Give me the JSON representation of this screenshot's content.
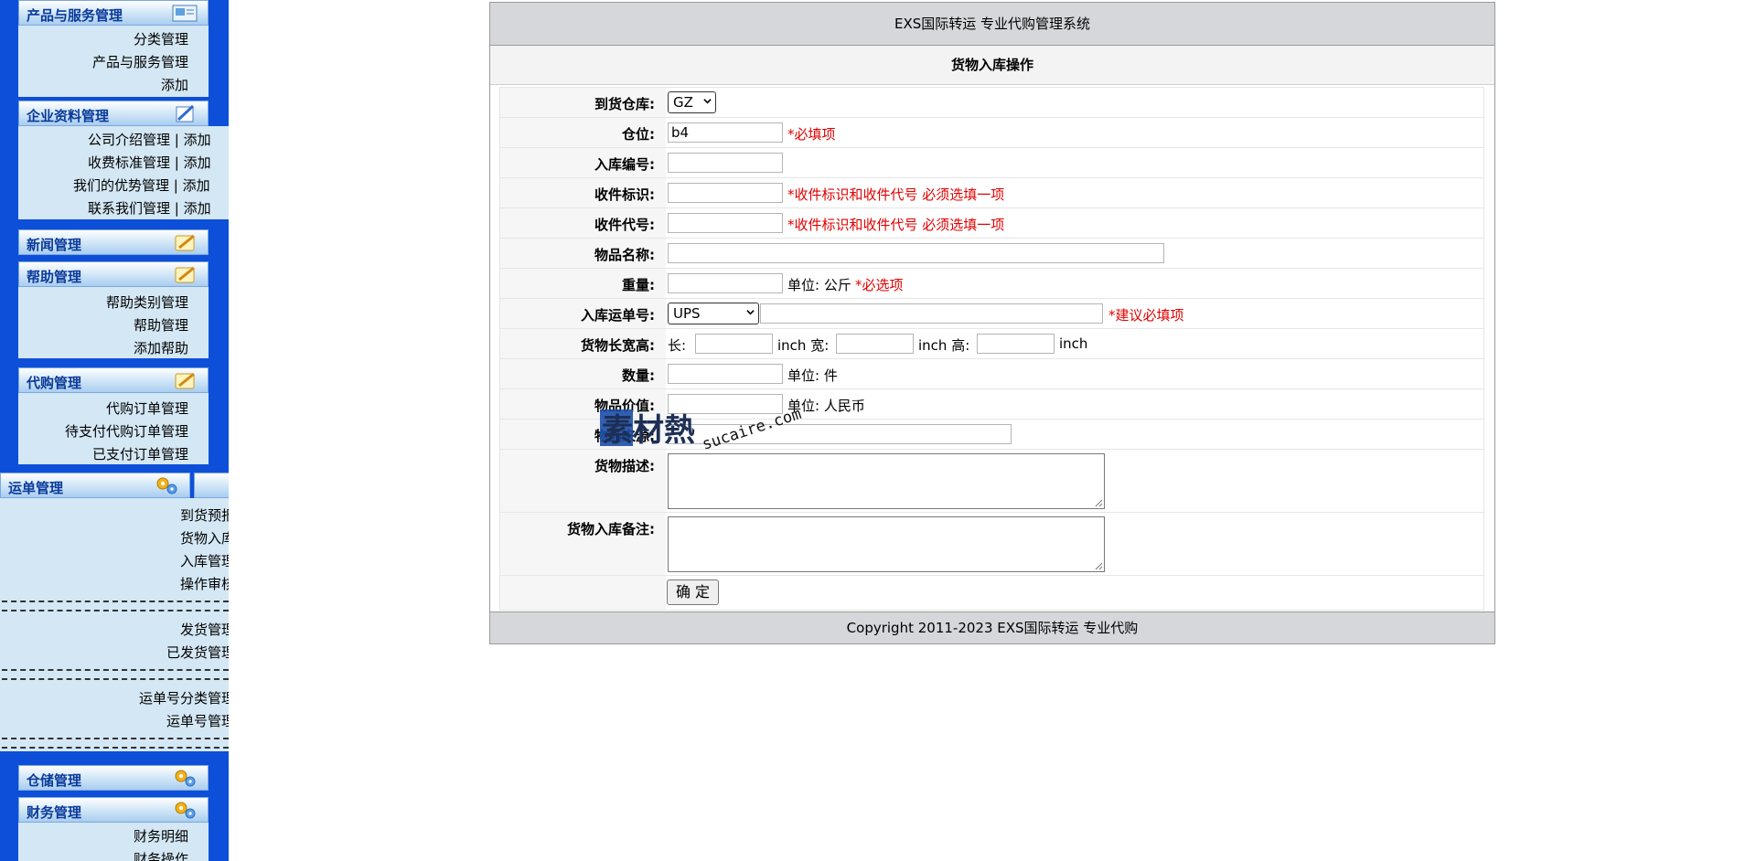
{
  "sidebar": {
    "product_group": {
      "title": "产品与服务管理",
      "items": [
        "分类管理",
        "产品与服务管理",
        "添加"
      ]
    },
    "company_group": {
      "title": "企业资料管理",
      "items": [
        "公司介绍管理 | 添加",
        "收费标准管理 | 添加",
        "我们的优势管理 | 添加",
        "联系我们管理 | 添加"
      ]
    },
    "news_group": {
      "title": "新闻管理"
    },
    "help_group": {
      "title": "帮助管理",
      "items": [
        "帮助类别管理",
        "帮助管理",
        "添加帮助"
      ]
    },
    "purchase_group": {
      "title": "代购管理",
      "items": [
        "代购订单管理",
        "待支付代购订单管理",
        "已支付订单管理"
      ]
    },
    "waybill_group": {
      "title": "运单管理",
      "items_a": [
        "到货预报",
        "货物入库",
        "入库管理",
        "操作审核"
      ],
      "separator": "=============================",
      "items_b": [
        "发货管理",
        "已发货管理"
      ],
      "items_c": [
        "运单号分类管理",
        "运单号管理"
      ]
    },
    "storage_group": {
      "title": "仓储管理"
    },
    "finance_group": {
      "title": "财务管理",
      "items": [
        "财务明细",
        "财务操作"
      ]
    }
  },
  "header": {
    "title": "EXS国际转运 专业代购管理系统"
  },
  "section": {
    "title": "货物入库操作"
  },
  "form": {
    "warehouse": {
      "label": "到货仓库:",
      "value": "GZ"
    },
    "location": {
      "label": "仓位:",
      "value": "b4",
      "hint": "*必填项"
    },
    "inbound_no": {
      "label": "入库编号:",
      "value": ""
    },
    "recipient_mark": {
      "label": "收件标识:",
      "value": "",
      "hint": "*收件标识和收件代号 必须选填一项"
    },
    "recipient_code": {
      "label": "收件代号:",
      "value": "",
      "hint": "*收件标识和收件代号 必须选填一项"
    },
    "item_name": {
      "label": "物品名称:",
      "value": ""
    },
    "weight": {
      "label": "重量:",
      "value": "",
      "unit": "单位: 公斤",
      "hint": "*必选项"
    },
    "tracking": {
      "label": "入库运单号:",
      "carrier": "UPS",
      "value": "",
      "hint": "*建议必填项"
    },
    "dimensions": {
      "label": "货物长宽高:",
      "length_label": "长:",
      "width_label": "inch 宽:",
      "height_label": "inch 高:",
      "unit": "inch"
    },
    "quantity": {
      "label": "数量:",
      "value": "",
      "unit": "单位: 件"
    },
    "item_value": {
      "label": "物品价值:",
      "value": "",
      "unit": "单位: 人民币"
    },
    "item_source": {
      "label": "物品来源:",
      "value": ""
    },
    "description": {
      "label": "货物描述:",
      "value": ""
    },
    "remarks": {
      "label": "货物入库备注:",
      "value": ""
    },
    "submit_label": "确 定"
  },
  "footer": {
    "text": "Copyright 2011-2023 EXS国际转运 专业代购"
  },
  "watermark": {
    "brand": "素材熱",
    "url": "sucaire.com"
  },
  "colors": {
    "sidebar_bg": "#0d4fd8",
    "submenu_bg": "#d4e7f4",
    "header_text": "#0a3a9a",
    "hint_red": "#e00000",
    "title_bar_bg": "#d6d7db"
  }
}
